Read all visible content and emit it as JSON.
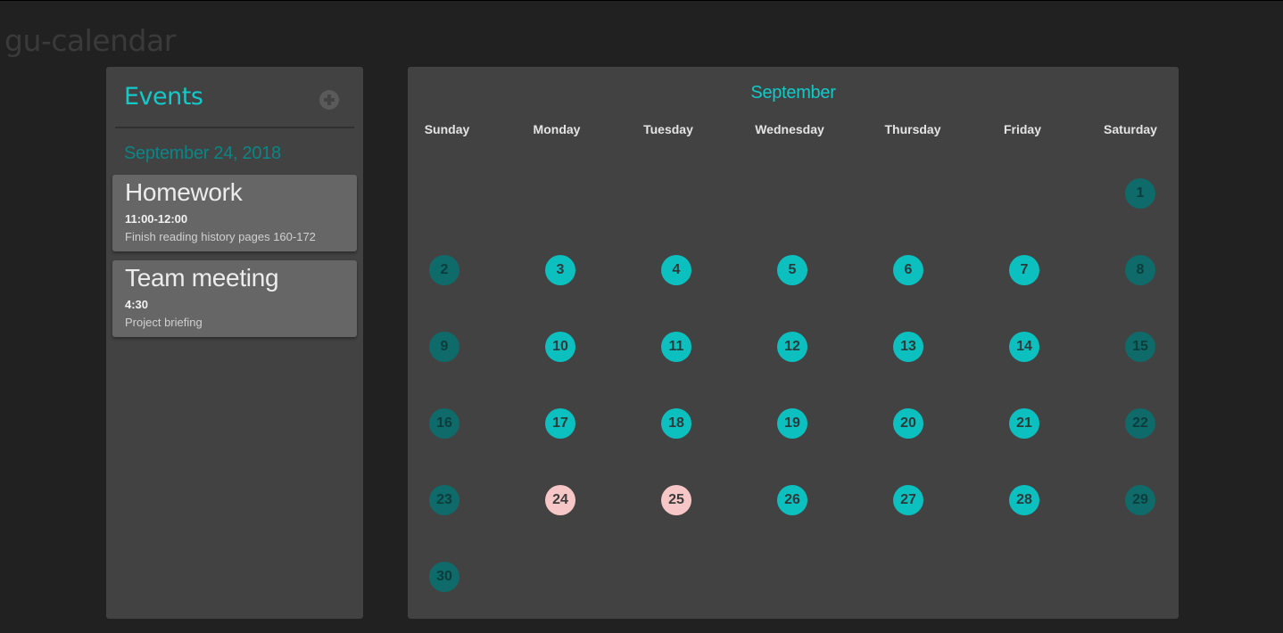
{
  "app": {
    "title": "gu-calendar"
  },
  "events_panel": {
    "title": "Events",
    "add_icon": "plus-circle-icon",
    "selected_date": "September 24, 2018",
    "events": [
      {
        "name": "Homework",
        "time": "11:00-12:00",
        "description": "Finish reading history pages 160-172"
      },
      {
        "name": "Team meeting",
        "time": "4:30",
        "description": "Project briefing"
      }
    ]
  },
  "calendar": {
    "month": "September",
    "weekdays": [
      "Sunday",
      "Monday",
      "Tuesday",
      "Wednesday",
      "Thursday",
      "Friday",
      "Saturday"
    ],
    "first_weekday_index": 6,
    "days_in_month": 30,
    "days_with_events": [
      24,
      25
    ],
    "colors": {
      "weekday": "#0cc0c0",
      "weekend": "#0f6a6a",
      "event_day": "#f7c6c6",
      "accent": "#14c9c9"
    }
  }
}
